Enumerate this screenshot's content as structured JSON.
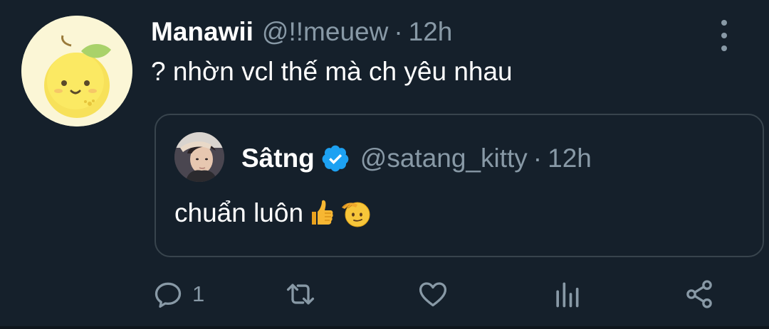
{
  "tweet": {
    "author_name": "Manawii",
    "author_handle": "@!!meuew",
    "separator": "·",
    "time": "12h",
    "text": "? nhờn vcl thế mà ch yêu nhau",
    "avatar_icon": "lemon-avatar",
    "more_icon": "more-vertical-icon"
  },
  "quote": {
    "author_name": "Sâtng",
    "author_handle": "@satang_kitty",
    "separator": "·",
    "time": "12h",
    "verified": true,
    "text": "chuẩn luôn",
    "emojis": [
      "thumbs-up-emoji",
      "saluting-face-emoji"
    ]
  },
  "actions": {
    "reply_count": "1",
    "icons": [
      "reply-icon",
      "retweet-icon",
      "like-icon",
      "analytics-icon",
      "share-icon"
    ]
  },
  "colors": {
    "background": "#15202b",
    "secondary_text": "#8899a6",
    "border": "#38444d",
    "verified": "#1da1f2"
  }
}
